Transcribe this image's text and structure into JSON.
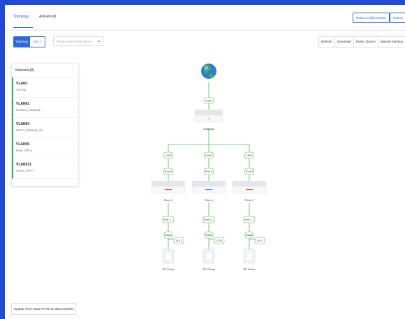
{
  "tabs": [
    {
      "label": "Topology"
    },
    {
      "label": "Advanced"
    }
  ],
  "top_buttons": {
    "return_old": "Return to Old version",
    "report": "Report"
  },
  "view_toggle": {
    "topology": "Topology",
    "list": "List ⓘ"
  },
  "device_search": {
    "placeholder": "Please search the device"
  },
  "toolbar": {
    "refresh": "Refresh",
    "download": "Download",
    "detect_device": "Detect Device",
    "manual_settings": "Manual Settings"
  },
  "networks": {
    "header": "Networks(8)",
    "items": [
      {
        "name": "VLAN1",
        "desc": "VLAN1"
      },
      {
        "name": "VLAN61",
        "desc": "Camera_Network"
      },
      {
        "name": "VLAN64",
        "desc": "Wired_Network_64"
      },
      {
        "name": "VLAN95",
        "desc": "New_Office"
      },
      {
        "name": "VLAN231",
        "desc": "Guest_Wi-Fi"
      }
    ]
  },
  "topology": {
    "internet_port": "Port0",
    "gateway": "Gateway",
    "lan_ports": [
      "LAN2",
      "LAN3",
      "LAN1"
    ],
    "switch_ports": [
      "Port 2",
      "Port 2",
      "Port 3"
    ],
    "floors": [
      "Floor 3",
      "Floor 1",
      "Floor 2"
    ],
    "port_down": [
      "Port 1...",
      "Port 1...",
      "Port 1..."
    ],
    "radio": [
      "Radio",
      "Radio",
      "Radio"
    ],
    "ap_count": [
      "(1/1)",
      "(1/1)",
      "(1/1)"
    ],
    "ap_groups": [
      "AP Group",
      "AP Group",
      "AP Group"
    ]
  },
  "update_time": "Update Time: 2022-07-09 11:36(Complete)",
  "colors": {
    "accent": "#2d6ad6",
    "line": "#5cb85c",
    "bg": "#1f49d6"
  }
}
